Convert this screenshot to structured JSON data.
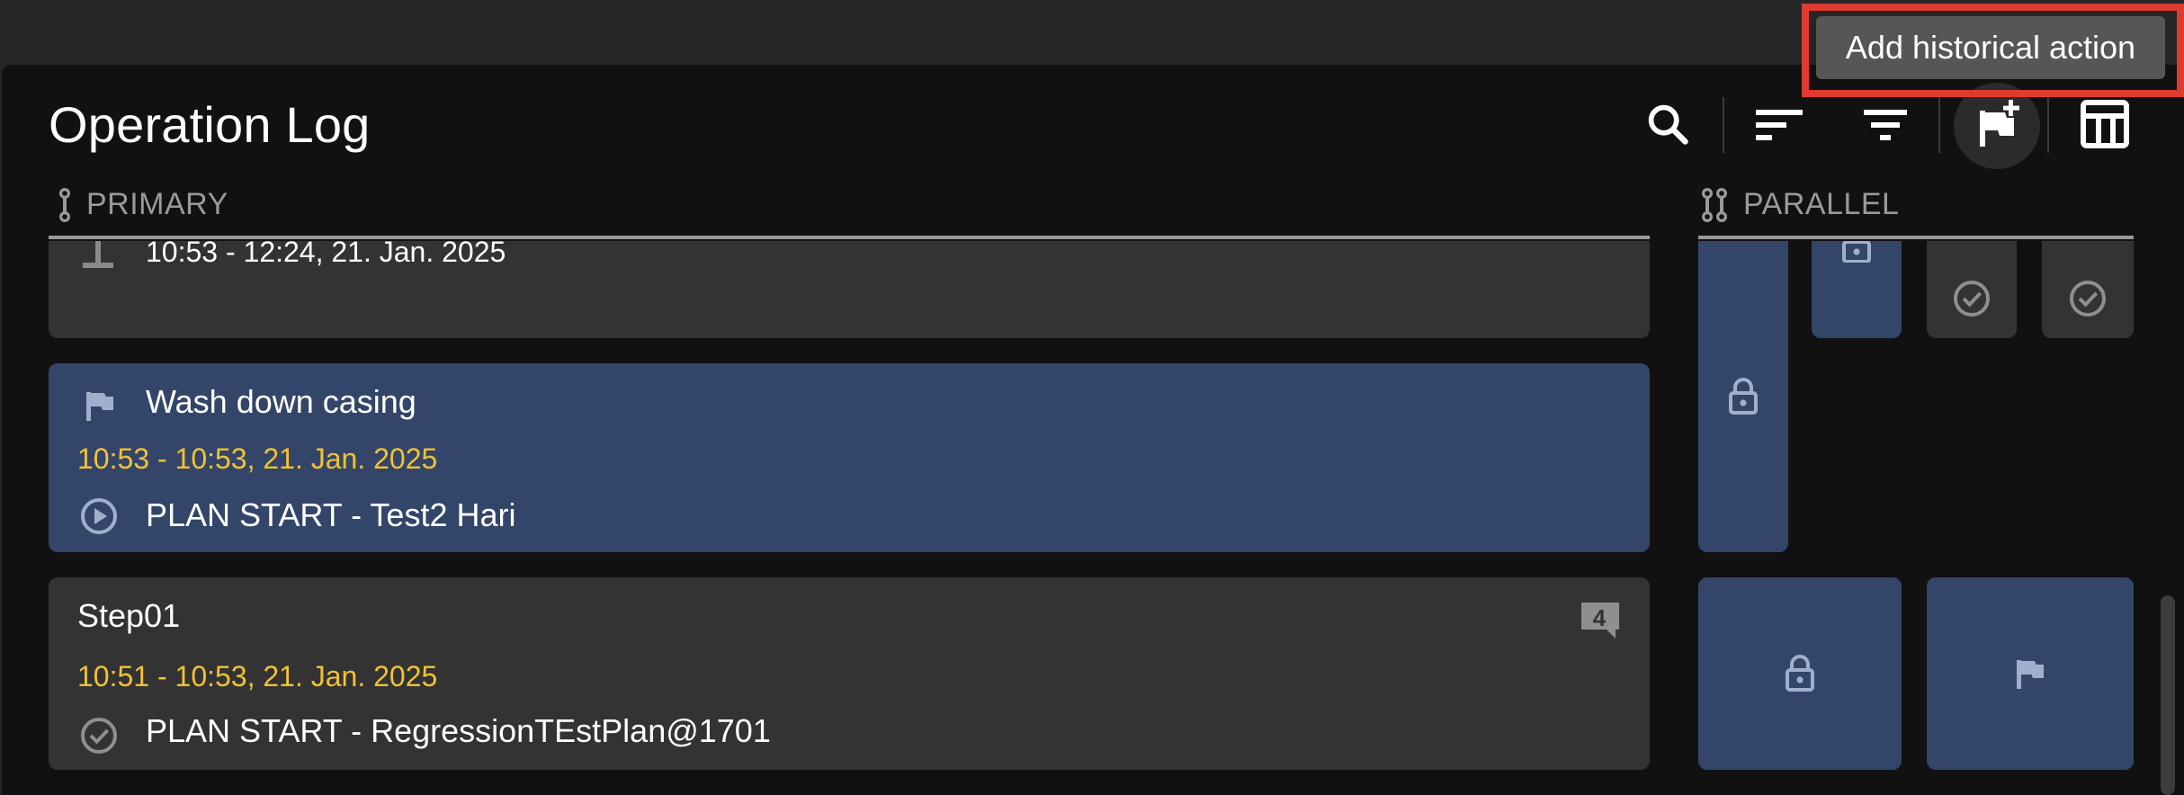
{
  "header": {
    "title": "Operation Log",
    "toolbar": {
      "search_icon": "search-icon",
      "sort_icon": "sort-icon",
      "filter_icon": "filter-icon",
      "add_flag_icon": "flag-add-icon",
      "layout_icon": "layout-icon"
    }
  },
  "tooltip": {
    "text": "Add historical action"
  },
  "sections": {
    "primary": {
      "label": "PRIMARY"
    },
    "parallel": {
      "label": "PARALLEL"
    }
  },
  "cards": [
    {
      "time": "10:53 - 12:24, 21. Jan. 2025",
      "style": "gray"
    },
    {
      "title": "Wash down casing",
      "time": "10:53 - 10:53, 21. Jan. 2025",
      "line": "PLAN START - Test2 Hari",
      "icon": "play-circle-icon",
      "title_icon": "flag-icon",
      "style": "blue"
    },
    {
      "title": "Step01",
      "time": "10:51 - 10:53, 21. Jan. 2025",
      "line": "PLAN START - RegressionTEstPlan@1701",
      "icon": "check-circle-icon",
      "comment_count": "4",
      "style": "gray"
    }
  ],
  "colors": {
    "accent_blue": "#33466a",
    "time_yellow": "#f2c233",
    "card_gray": "#333333",
    "highlight_red": "#e03b30"
  }
}
